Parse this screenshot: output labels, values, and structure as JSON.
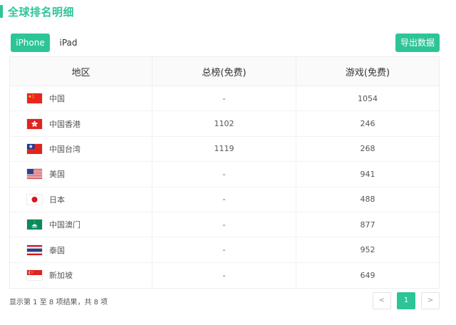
{
  "section": {
    "title": "全球排名明细"
  },
  "toolbar": {
    "tabs": [
      {
        "label": "iPhone",
        "active": true
      },
      {
        "label": "iPad",
        "active": false
      }
    ],
    "export_label": "导出数据"
  },
  "table": {
    "headers": [
      "地区",
      "总榜(免费)",
      "游戏(免费)"
    ],
    "rows": [
      {
        "region": "中国",
        "overall": "-",
        "games": "1054",
        "flag": "cn-flag-icon"
      },
      {
        "region": "中国香港",
        "overall": "1102",
        "games": "246",
        "flag": "hk-flag-icon"
      },
      {
        "region": "中国台湾",
        "overall": "1119",
        "games": "268",
        "flag": "tw-flag-icon"
      },
      {
        "region": "美国",
        "overall": "-",
        "games": "941",
        "flag": "us-flag-icon"
      },
      {
        "region": "日本",
        "overall": "-",
        "games": "488",
        "flag": "jp-flag-icon"
      },
      {
        "region": "中国澳门",
        "overall": "-",
        "games": "877",
        "flag": "mo-flag-icon"
      },
      {
        "region": "泰国",
        "overall": "-",
        "games": "952",
        "flag": "th-flag-icon"
      },
      {
        "region": "新加坡",
        "overall": "-",
        "games": "649",
        "flag": "sg-flag-icon"
      }
    ]
  },
  "footer": {
    "summary": "显示第 1 至 8 项结果，共 8 项"
  },
  "pagination": {
    "prev": "<",
    "current": "1",
    "next": ">"
  },
  "colors": {
    "accent": "#2dc598"
  }
}
